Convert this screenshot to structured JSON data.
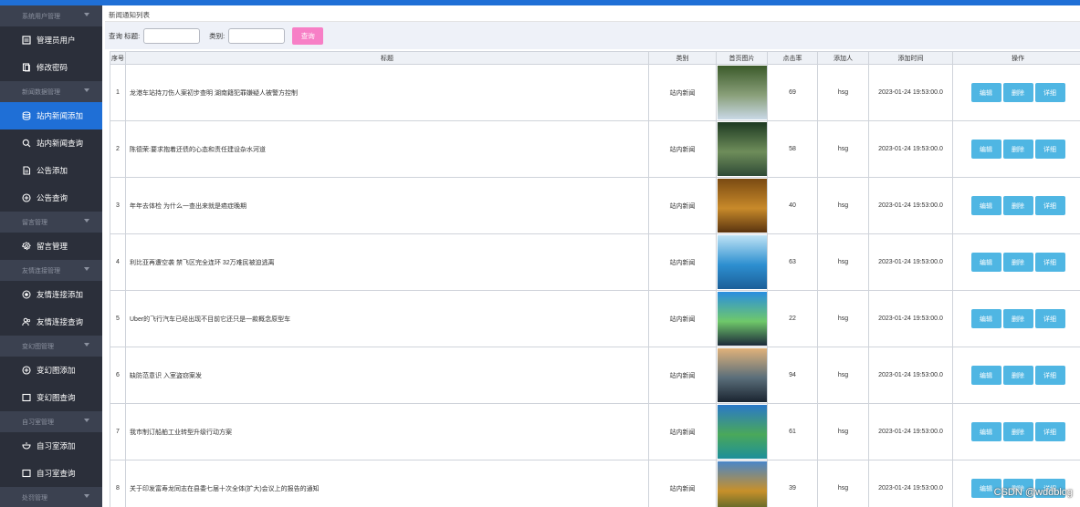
{
  "sidebar": {
    "items": [
      {
        "type": "group",
        "label": "系统用户管理"
      },
      {
        "type": "item",
        "label": "管理员用户",
        "icon": "list-icon"
      },
      {
        "type": "item",
        "label": "修改密码",
        "icon": "copy-icon"
      },
      {
        "type": "group",
        "label": "新闻数据管理"
      },
      {
        "type": "item",
        "label": "站内新闻添加",
        "icon": "database-icon",
        "active": true
      },
      {
        "type": "item",
        "label": "站内新闻查询",
        "icon": "search-icon"
      },
      {
        "type": "item",
        "label": "公告添加",
        "icon": "document-icon"
      },
      {
        "type": "item",
        "label": "公告查询",
        "icon": "circle-plus-icon"
      },
      {
        "type": "group",
        "label": "留言管理"
      },
      {
        "type": "item",
        "label": "留言管理",
        "icon": "gear-icon"
      },
      {
        "type": "group",
        "label": "友情连接管理"
      },
      {
        "type": "item",
        "label": "友情连接添加",
        "icon": "target-icon"
      },
      {
        "type": "item",
        "label": "友情连接查询",
        "icon": "people-icon"
      },
      {
        "type": "group",
        "label": "变幻图管理"
      },
      {
        "type": "item",
        "label": "变幻图添加",
        "icon": "circle-plus-icon"
      },
      {
        "type": "item",
        "label": "变幻图查询",
        "icon": "square-icon"
      },
      {
        "type": "group",
        "label": "自习室管理"
      },
      {
        "type": "item",
        "label": "自习室添加",
        "icon": "cup-icon"
      },
      {
        "type": "item",
        "label": "自习室查询",
        "icon": "square-icon"
      },
      {
        "type": "group",
        "label": "处罚管理"
      }
    ]
  },
  "page": {
    "title": "新闻通知列表"
  },
  "search": {
    "label_title": "查询 标题:",
    "label_category": "类别:",
    "button": "查询"
  },
  "table": {
    "columns": [
      "序号",
      "标题",
      "类别",
      "首页图片",
      "点击率",
      "添加人",
      "添加时间",
      "操作"
    ],
    "rows": [
      {
        "idx": "1",
        "title": "龙港车站持刀伤人案初步查明 湖南籍犯罪嫌疑人被警方控制",
        "category": "站内新闻",
        "clicks": "69",
        "author": "hsg",
        "time": "2023-01-24 19:53:00.0",
        "thumb": [
          "#3b5a2a",
          "#8aa07a",
          "#c9d8e6"
        ]
      },
      {
        "idx": "2",
        "title": "陈德荣:要求抱着还债的心态和责任建设杂水河道",
        "category": "站内新闻",
        "clicks": "58",
        "author": "hsg",
        "time": "2023-01-24 19:53:00.0",
        "thumb": [
          "#1e3a22",
          "#6e8d5a",
          "#2f4a36"
        ]
      },
      {
        "idx": "3",
        "title": "年年去体检 为什么一查出来就是癌症晚期",
        "category": "站内新闻",
        "clicks": "40",
        "author": "hsg",
        "time": "2023-01-24 19:53:00.0",
        "thumb": [
          "#7a4a12",
          "#c88a2a",
          "#5a3410"
        ]
      },
      {
        "idx": "4",
        "title": "利比亚再遭空袭 禁飞区完全连环 32万难民被迫逃离",
        "category": "站内新闻",
        "clicks": "63",
        "author": "hsg",
        "time": "2023-01-24 19:53:00.0",
        "thumb": [
          "#bfe3f5",
          "#2d8fd0",
          "#1b5f99"
        ]
      },
      {
        "idx": "5",
        "title": "Uber的飞行汽车已经出现不目前它还只是一款概念原型车",
        "category": "站内新闻",
        "clicks": "22",
        "author": "hsg",
        "time": "2023-01-24 19:53:00.0",
        "thumb": [
          "#2a8ee0",
          "#6fc86a",
          "#1c2a3a"
        ]
      },
      {
        "idx": "6",
        "title": "缺防范意识 入室盗窃案发",
        "category": "站内新闻",
        "clicks": "94",
        "author": "hsg",
        "time": "2023-01-24 19:53:00.0",
        "thumb": [
          "#e0b27a",
          "#5a6e7a",
          "#1a2430"
        ]
      },
      {
        "idx": "7",
        "title": "我市制订船舶工业转型升级行动方案",
        "category": "站内新闻",
        "clicks": "61",
        "author": "hsg",
        "time": "2023-01-24 19:53:00.0",
        "thumb": [
          "#2a78c8",
          "#4aa85a",
          "#1d8f9a"
        ]
      },
      {
        "idx": "8",
        "title": "关于印发富寿龙同志在县委七届十次全体(扩大)会议上的报告的通知",
        "category": "站内新闻",
        "clicks": "39",
        "author": "hsg",
        "time": "2023-01-24 19:53:00.0",
        "thumb": [
          "#4a86c8",
          "#c8902a",
          "#3a5a2a"
        ]
      }
    ],
    "actions": {
      "edit": "编辑",
      "delete": "删除",
      "detail": "详细"
    }
  },
  "watermark": "CSDN @wddblog",
  "colors": {
    "topbar": "#1f6fd6",
    "sidebar": "#2b2f3a",
    "active": "#1f6fd6",
    "search_btn": "#f77fc6",
    "op_btn": "#4fb6e3"
  }
}
